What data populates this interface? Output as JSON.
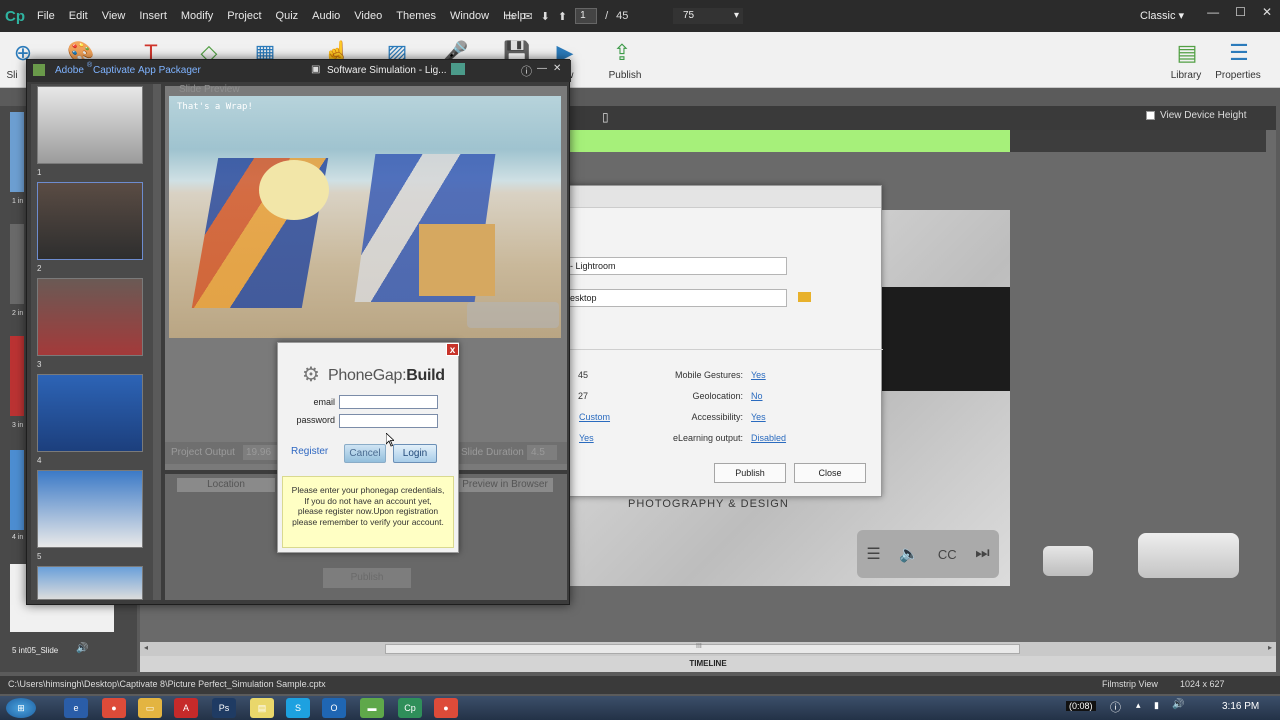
{
  "app": {
    "logo": "Cp",
    "menu": [
      "File",
      "Edit",
      "View",
      "Insert",
      "Modify",
      "Project",
      "Quiz",
      "Audio",
      "Video",
      "Themes",
      "Window",
      "Help"
    ],
    "current_slide": "1",
    "slide_sep": "/",
    "total_slides": "45",
    "zoom": "75",
    "workspace": "Classic"
  },
  "toolbar": {
    "left_labels": [
      "Sli"
    ],
    "publish_label": "Publish",
    "view_label": "iew",
    "library_label": "Library",
    "properties_label": "Properties"
  },
  "stage": {
    "view_device_height": "View Device Height",
    "brand_text": "PHOTOGRAPHY & DESIGN"
  },
  "publish_dialog": {
    "project_title_value": "- Lightroom",
    "location_value": "esktop",
    "stats": [
      "45",
      "27"
    ],
    "link_custom": "Custom",
    "link_yes_left": "Yes",
    "mobile_gestures_label": "Mobile Gestures:",
    "mobile_gestures_value": "Yes",
    "geolocation_label": "Geolocation:",
    "geolocation_value": "No",
    "accessibility_label": "Accessibility:",
    "accessibility_value": "Yes",
    "elearning_label": "eLearning output:",
    "elearning_value": "Disabled",
    "publish_btn": "Publish",
    "close_btn": "Close"
  },
  "packager": {
    "title": "Adobe",
    "title_reg": "®",
    "title_product": "Captivate",
    "title_rest": "App Packager",
    "doc_tab": "Software Simulation - Lig...",
    "thumb_numbers": [
      "1",
      "2",
      "3",
      "4",
      "5"
    ],
    "slide_preview": "Slide Preview",
    "thats_wrap": "That's a Wrap!",
    "project_output_label": "Project Output",
    "project_output_value": "19.96",
    "slide_duration_label": "Slide Duration",
    "slide_duration_value": "4.5",
    "location_btn": "Location",
    "preview_browser_btn": "Preview in Browser",
    "publish_btn": "Publish"
  },
  "phonegap": {
    "brand_light": "PhoneGap",
    "brand_sep": ":",
    "brand_bold": "Build",
    "email_label": "email",
    "password_label": "password",
    "email_value": "",
    "password_value": "",
    "register_label": "Register",
    "cancel_label": "Cancel",
    "login_label": "Login",
    "message": "Please enter your phonegap credentials, If you do not have an account yet, please register now.Upon registration please remember to verify your account.",
    "close_glyph": "x"
  },
  "filmstrip": {
    "slide_label": "5 int05_Slide",
    "left_labels": [
      "1 in",
      "2 in",
      "3 in",
      "4 in"
    ]
  },
  "timeline": {
    "label": "TIMELINE",
    "hscroll_mark": "III"
  },
  "status": {
    "path": "C:\\Users\\himsingh\\Desktop\\Captivate 8\\Picture Perfect_Simulation Sample.cptx",
    "view": "Filmstrip View",
    "size": "1024 x 627"
  },
  "taskbar": {
    "time": "3:16 PM",
    "timer": "(0:08)",
    "pinned": [
      "explorer",
      "ie",
      "chrome",
      "folder",
      "acrobat",
      "photoshop",
      "notes",
      "skype",
      "outlook",
      "android",
      "captivate",
      "chrome2"
    ]
  },
  "colors": {
    "accent": "#2b7bbb",
    "timebar_green": "#a6f07a",
    "link": "#2a6bbf",
    "phonegap_close": "#c8332a",
    "message_bg": "#ffffc4"
  }
}
